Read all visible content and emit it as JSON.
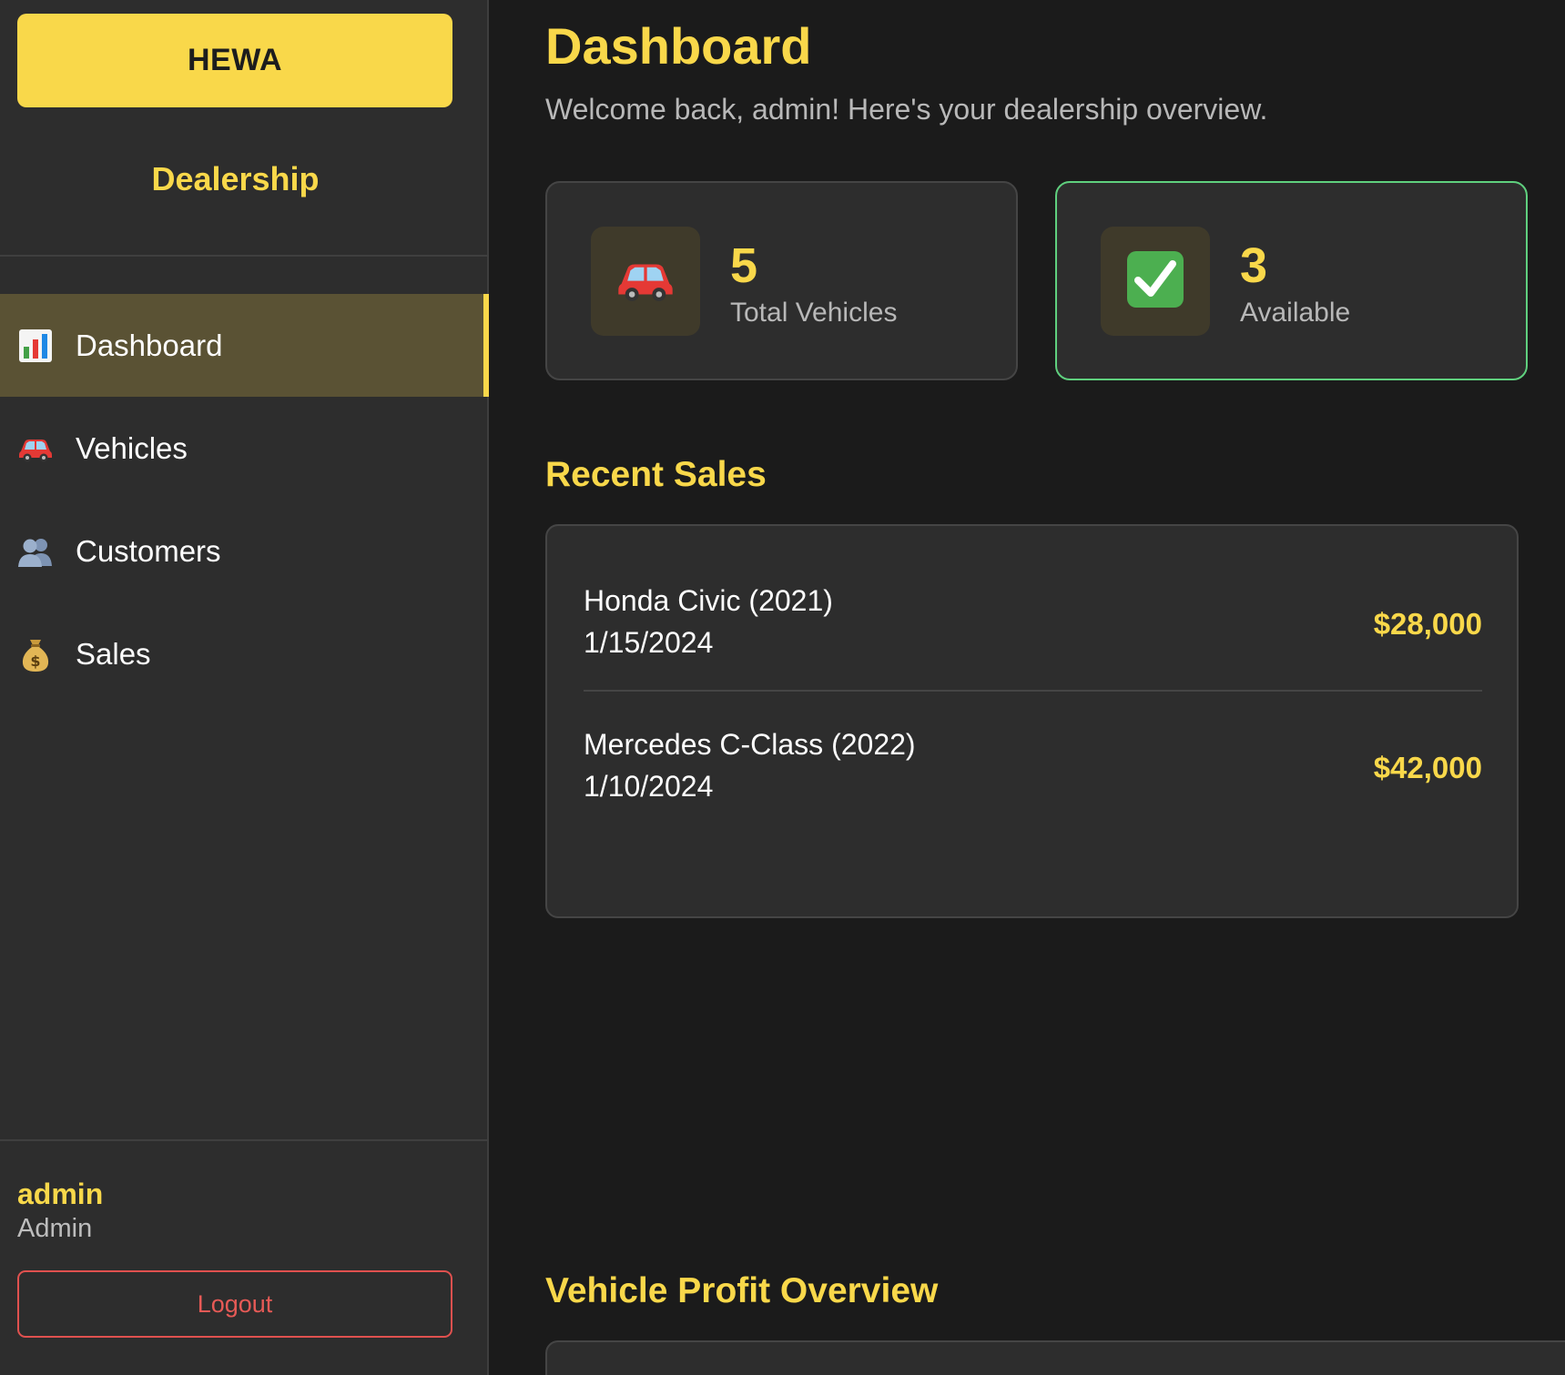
{
  "sidebar": {
    "brand": "HEWA",
    "subtitle": "Dealership",
    "nav": [
      {
        "label": "Dashboard",
        "icon": "bar-chart-icon",
        "active": true
      },
      {
        "label": "Vehicles",
        "icon": "car-icon",
        "active": false
      },
      {
        "label": "Customers",
        "icon": "people-icon",
        "active": false
      },
      {
        "label": "Sales",
        "icon": "money-bag-icon",
        "active": false
      }
    ],
    "user": {
      "name": "admin",
      "role": "Admin"
    },
    "logout_label": "Logout"
  },
  "main": {
    "title": "Dashboard",
    "subtitle": "Welcome back, admin! Here's your dealership overview.",
    "stats": [
      {
        "value": "5",
        "label": "Total Vehicles",
        "icon": "car-icon"
      },
      {
        "value": "3",
        "label": "Available",
        "icon": "check-mark-icon"
      }
    ],
    "recent_sales_title": "Recent Sales",
    "recent_sales": [
      {
        "vehicle": "Honda Civic (2021)",
        "date": "1/15/2024",
        "amount": "$28,000"
      },
      {
        "vehicle": "Mercedes C-Class (2022)",
        "date": "1/10/2024",
        "amount": "$42,000"
      }
    ],
    "profit_title": "Vehicle Profit Overview"
  },
  "colors": {
    "accent": "#f9d84a",
    "background": "#1b1b1b",
    "panel": "#2d2d2d",
    "success_border": "#5fd07e",
    "danger": "#e0514f"
  }
}
